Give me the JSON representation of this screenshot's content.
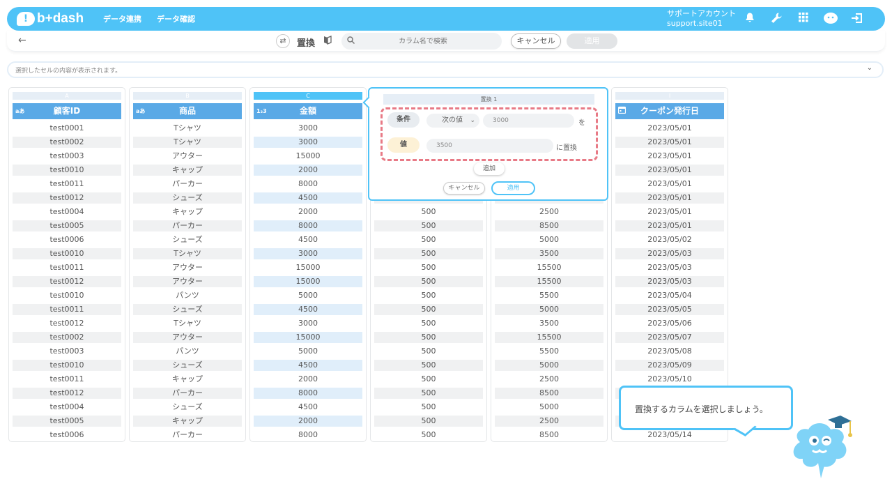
{
  "header": {
    "logo_text": "b+dash",
    "nav": [
      "データ連携",
      "データ確認"
    ],
    "account_name": "サポートアカウント",
    "account_id": "support.site01"
  },
  "toolbar": {
    "title": "置換",
    "search_placeholder": "カラム名で検索",
    "cancel_label": "キャンセル",
    "apply_label": "適用"
  },
  "cell_preview": {
    "text": "選択したセルの内容が表示されます。"
  },
  "columns": [
    {
      "letter": "A",
      "type": "aあ",
      "name": "顧客ID",
      "cells": [
        "test0001",
        "test0002",
        "test0003",
        "test0010",
        "test0011",
        "test0012",
        "test0004",
        "test0005",
        "test0006",
        "test0010",
        "test0011",
        "test0012",
        "test0010",
        "test0011",
        "test0012",
        "test0002",
        "test0003",
        "test0010",
        "test0011",
        "test0012",
        "test0004",
        "test0005",
        "test0006"
      ]
    },
    {
      "letter": "B",
      "type": "aあ",
      "name": "商品",
      "cells": [
        "Tシャツ",
        "Tシャツ",
        "アウター",
        "キャップ",
        "パーカー",
        "シューズ",
        "キャップ",
        "パーカー",
        "シューズ",
        "Tシャツ",
        "アウター",
        "アウター",
        "パンツ",
        "シューズ",
        "Tシャツ",
        "アウター",
        "パンツ",
        "シューズ",
        "キャップ",
        "パーカー",
        "シューズ",
        "キャップ",
        "パーカー"
      ]
    },
    {
      "letter": "C",
      "type": "1₂3",
      "name": "金額",
      "cells": [
        "3000",
        "3000",
        "15000",
        "2000",
        "8000",
        "4500",
        "2000",
        "8000",
        "4500",
        "3000",
        "15000",
        "15000",
        "5000",
        "4500",
        "3000",
        "15000",
        "5000",
        "4500",
        "2000",
        "8000",
        "4500",
        "2000",
        "8000"
      ]
    },
    {
      "letter": "",
      "type": "",
      "name": "",
      "cells": [
        "",
        "",
        "",
        "",
        "",
        "",
        "500",
        "500",
        "500",
        "500",
        "500",
        "500",
        "500",
        "500",
        "500",
        "500",
        "500",
        "500",
        "500",
        "500",
        "500",
        "500",
        "500"
      ]
    },
    {
      "letter": "",
      "type": "",
      "name": "",
      "cells": [
        "",
        "",
        "",
        "",
        "",
        "",
        "2500",
        "8500",
        "5000",
        "3500",
        "15500",
        "15500",
        "5500",
        "5000",
        "3500",
        "15500",
        "5500",
        "5000",
        "2500",
        "8500",
        "5000",
        "2500",
        "8500"
      ]
    },
    {
      "letter": "I",
      "type": "",
      "name": "クーポン発行日",
      "cells": [
        "2023/05/01",
        "2023/05/01",
        "2023/05/01",
        "2023/05/01",
        "2023/05/01",
        "2023/05/01",
        "2023/05/01",
        "2023/05/01",
        "2023/05/02",
        "2023/05/03",
        "2023/05/03",
        "2023/05/03",
        "2023/05/04",
        "2023/05/05",
        "2023/05/06",
        "2023/05/07",
        "2023/05/08",
        "2023/05/09",
        "2023/05/10",
        "",
        "",
        "",
        "2023/05/14"
      ]
    }
  ],
  "popup": {
    "title": "置換 1",
    "condition_label": "条件",
    "condition_op": "次の値",
    "condition_value": "3000",
    "condition_suffix": "を",
    "value_label": "値",
    "value_value": "3500",
    "value_suffix": "に置換",
    "add_label": "追加",
    "cancel_label": "キャンセル",
    "apply_label": "適用"
  },
  "tooltip": {
    "text": "置換するカラムを選択しましょう。"
  },
  "colors": {
    "accent": "#4fc3f7",
    "header_col": "#5aa9e6",
    "dashed_border": "#e87a86"
  }
}
